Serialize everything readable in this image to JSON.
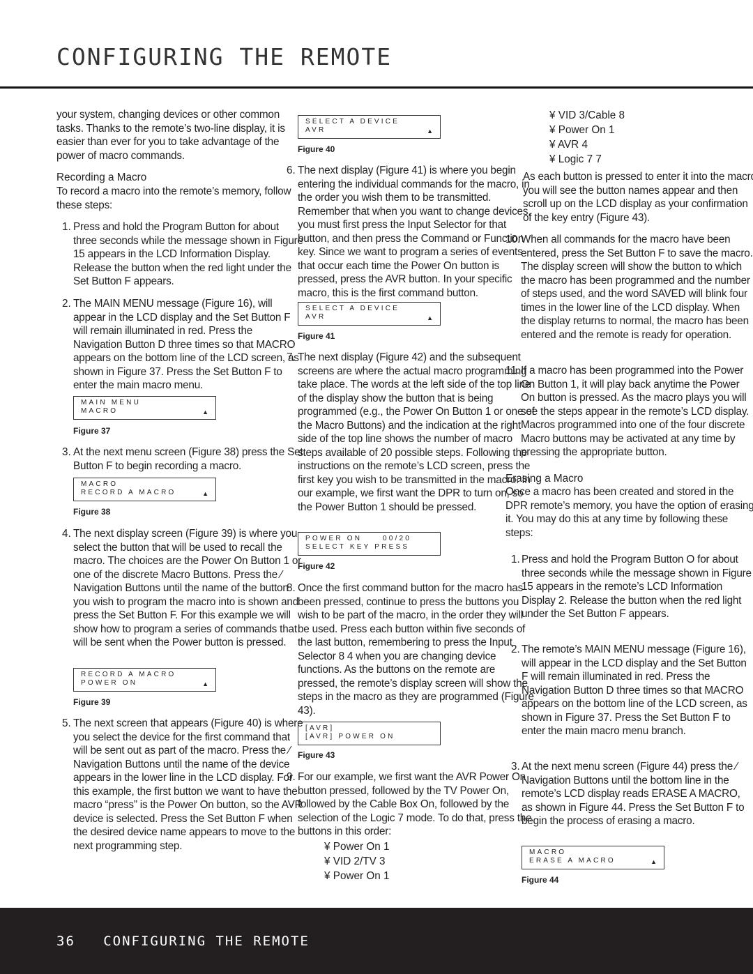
{
  "header": {
    "title": "CONFIGURING THE REMOTE"
  },
  "footer": {
    "text": "36   CONFIGURING THE REMOTE"
  },
  "col1": {
    "intro": "your system, changing devices or other common tasks. Thanks to the remote’s two-line display, it is easier than ever for you to take advantage of the power of macro commands.",
    "heading": "Recording a Macro",
    "intro2": "To record a macro into the remote’s memory, follow these steps:",
    "items": [
      {
        "n": "1.",
        "text": "Press and hold the Program Button for about three seconds while the message shown in Figure 15 appears in the LCD Information Display. Release the button when the red light under the Set Button F appears."
      },
      {
        "n": "2.",
        "text": "The MAIN MENU message (Figure 16), will appear in the LCD display and the Set Button F will remain illuminated in red. Press the Navigation Button D three times so that MACRO appears on the bottom line of the LCD screen, as shown in Figure 37. Press the Set Button F to enter the main macro menu."
      },
      {
        "n": "3.",
        "text": "At the next menu screen (Figure 38) press the Set Button F to begin recording a macro."
      },
      {
        "n": "4.",
        "text": "The next display screen (Figure 39) is where you select the button that will be used to recall the macro. The choices are the Power On Button 1 or one of the discrete Macro Buttons. Press the ⁄ Navigation Buttons until the name of the button you wish to program the macro into is shown and press the Set Button F. For this example we will show how to program a series of commands that will be sent when the Power button is pressed."
      },
      {
        "n": "5.",
        "text": "The next screen that appears (Figure 40) is where you select the device for the first command that will be sent out as part of the macro. Press the ⁄ Navigation Buttons until the name of the device appears in the lower line in the LCD display. For this example, the first button we want to have the macro “press” is the Power On button, so the AVR device is selected. Press the Set Button F when the desired device name appears to move to the next programming step."
      }
    ]
  },
  "col2": {
    "items": [
      {
        "n": "6.",
        "text": "The next display (Figure 41) is where you begin entering the individual commands for the macro, in the order you wish them to be transmitted. Remember that when you want to change devices, you must first press the Input Selector for that button, and then press the Command or Function key. Since we want to program a series of events that occur each time the Power On button is pressed, press the AVR button. In your specific macro, this is the first command button."
      },
      {
        "n": "7.",
        "text": "The next display (Figure 42) and the subsequent screens are where the actual macro programming take place. The words at the left side of the top line of the display show the button that is being programmed (e.g., the Power On Button 1 or one of the Macro Buttons) and the indication at the right side of the top line shows the number of macro steps available of 20 possible steps. Following the instructions on the remote’s LCD screen, press the first key you wish to be transmitted in the macro. In our example, we first want the DPR to turn on, so the Power Button 1 should be pressed."
      },
      {
        "n": "8.",
        "text": "Once the first command button for the macro has been pressed, continue to press the buttons you wish to be part of the macro, in the order they will be used. Press each button within five seconds of the last button, remembering to press the Input Selector 8 4 when you are changing device functions. As the buttons on the remote are pressed, the remote’s display screen will show the steps in the macro as they are programmed (Figure 43)."
      },
      {
        "n": "9.",
        "text": "For our example, we first want the AVR Power On button pressed, followed by the TV Power On, followed by the Cable Box On, followed by the selection of the Logic 7 mode. To do that, press the buttons in this order:"
      }
    ],
    "bullets": [
      "¥ Power On 1",
      "¥ VID 2/TV 3",
      "¥ Power On 1"
    ]
  },
  "col3": {
    "bullets": [
      "¥ VID 3/Cable 8",
      "¥ Power On 1",
      "¥ AVR 4",
      "¥ Logic 7 7"
    ],
    "para": "As each button is pressed to enter it into the macro you will see the button names appear and then scroll up on the LCD display as your confirmation of the key entry (Figure 43).",
    "items": [
      {
        "n": "10.",
        "text": "When all commands for the macro have been entered, press the Set Button F to save the macro. The display screen will show the button to which the macro has been programmed and the number of steps used, and the word SAVED will blink four times in the lower line of the LCD display. When the display returns to normal, the macro has been entered and the remote is ready for operation."
      },
      {
        "n": "11.",
        "text": "If a macro has been programmed into the Power On Button 1, it will play back anytime the Power On button is pressed. As the macro plays you will see the steps appear in the remote’s LCD display. Macros programmed into one of the four discrete Macro buttons may be activated at any time by pressing the appropriate button."
      }
    ],
    "heading": "Erasing a Macro",
    "intro": "Once a macro has been created and stored in the DPR remote’s memory, you have the option of erasing it. You may do this at any time by following these steps:",
    "erase_items": [
      {
        "n": "1.",
        "text": "Press and hold the Program Button O for about three seconds while the message shown in Figure 15 appears in the remote’s LCD Information Display 2. Release the button when the red light under the Set Button F appears."
      },
      {
        "n": "2.",
        "text": "The remote’s MAIN MENU message (Figure 16), will appear in the LCD display and the Set Button F will remain illuminated in red. Press the Navigation Button D three times so that MACRO appears on the bottom line of the LCD screen, as shown in Figure 37. Press the Set Button F to enter the main macro menu branch."
      },
      {
        "n": "3.",
        "text": "At the next menu screen (Figure 44) press the ⁄ Navigation Buttons until the bottom line in the remote’s LCD display reads ERASE A MACRO, as shown in Figure 44. Press the Set Button F to begin the process of erasing a macro."
      }
    ]
  },
  "figures": [
    {
      "caption": "Figure 37",
      "line1": "MAIN MENU",
      "line2": "MACRO",
      "arrow": "▲"
    },
    {
      "caption": "Figure 38",
      "line1": "MACRO",
      "line2": "RECORD A MACRO",
      "arrow": "▲"
    },
    {
      "caption": "Figure 39",
      "line1": "RECORD A MACRO",
      "line2": "POWER ON",
      "arrow": "▲"
    },
    {
      "caption": "Figure 40",
      "line1": "SELECT A DEVICE",
      "line2": "AVR",
      "arrow": "▲"
    },
    {
      "caption": "Figure 41",
      "line1": "SELECT A DEVICE",
      "line2": "AVR",
      "arrow": "▲"
    },
    {
      "caption": "Figure 42",
      "line1": "POWER ON     00/20",
      "line2": "SELECT KEY PRESS",
      "arrow": ""
    },
    {
      "caption": "Figure 43",
      "line1": "[AVR]",
      "line2": "[AVR] POWER ON",
      "arrow": ""
    },
    {
      "caption": "Figure 44",
      "line1": "MACRO",
      "line2": "ERASE A MACRO",
      "arrow": "▲"
    }
  ]
}
